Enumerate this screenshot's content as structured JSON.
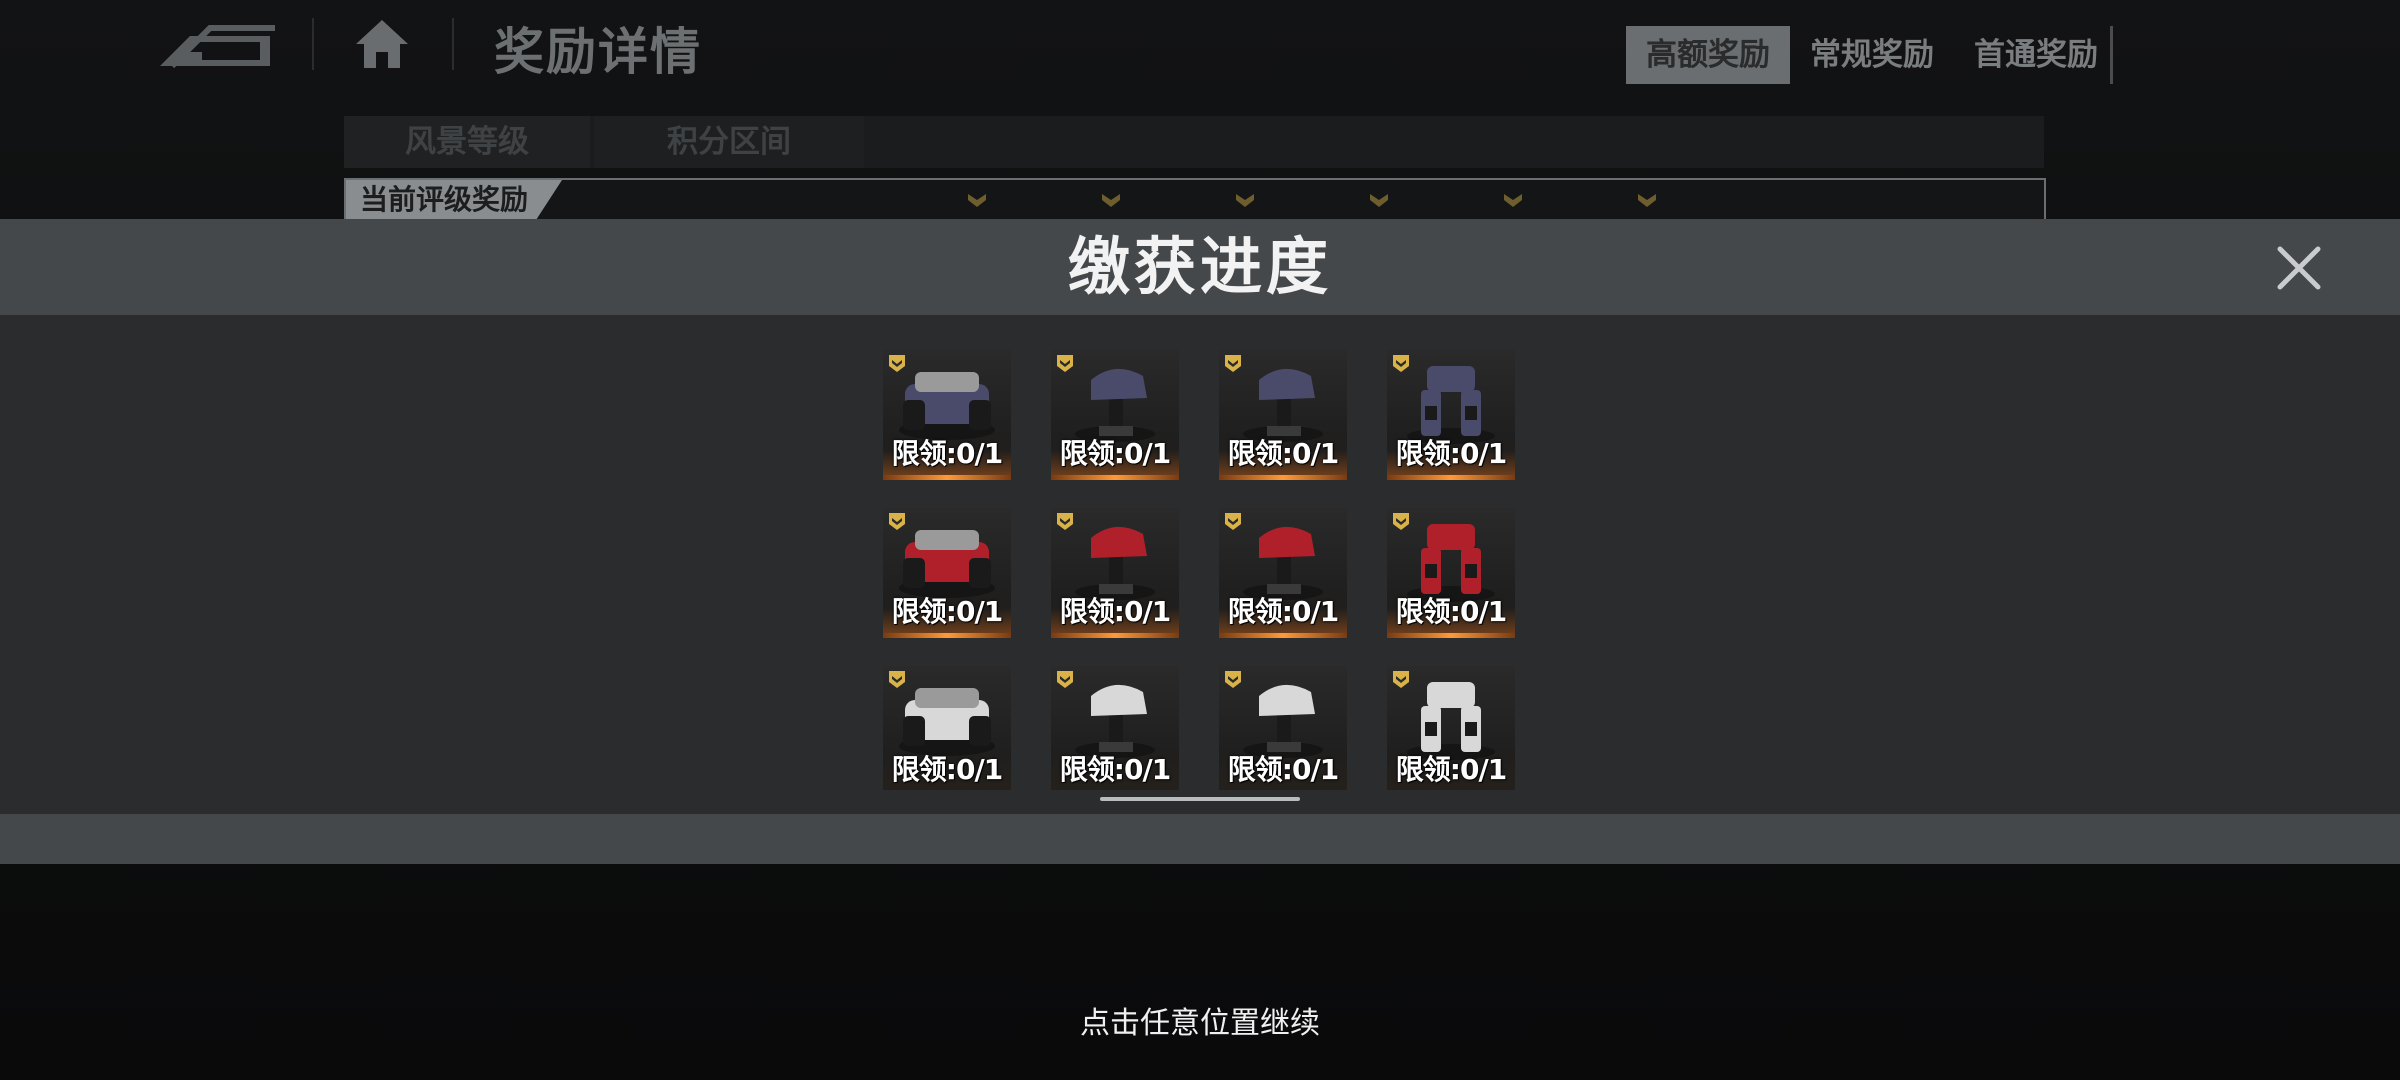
{
  "background": {
    "page_title": "奖励详情",
    "tabs": [
      {
        "label": "高额奖励",
        "active": true
      },
      {
        "label": "常规奖励",
        "active": false
      },
      {
        "label": "首通奖励",
        "active": false
      }
    ],
    "subhead": {
      "col1": "风景等级",
      "col2": "积分区间"
    },
    "rank_label": "当前评级奖励"
  },
  "modal": {
    "title": "缴获进度",
    "items": [
      {
        "name": "mech-part-1",
        "limit": "限领:0/1",
        "color": "#4a4a6a",
        "icon": "navy-shoulder-part",
        "glow": true
      },
      {
        "name": "mech-part-2",
        "limit": "限领:0/1",
        "color": "#4a4a6a",
        "icon": "navy-arm-part",
        "glow": true
      },
      {
        "name": "mech-part-3",
        "limit": "限领:0/1",
        "color": "#4a4a6a",
        "icon": "navy-arm-part",
        "glow": true
      },
      {
        "name": "mech-part-4",
        "limit": "限领:0/1",
        "color": "#4a4a6a",
        "icon": "navy-legs-part",
        "glow": true
      },
      {
        "name": "mech-part-5",
        "limit": "限领:0/1",
        "color": "#b0202a",
        "icon": "red-torso-part",
        "glow": true
      },
      {
        "name": "mech-part-6",
        "limit": "限领:0/1",
        "color": "#b0202a",
        "icon": "red-arm-part",
        "glow": true
      },
      {
        "name": "mech-part-7",
        "limit": "限领:0/1",
        "color": "#b0202a",
        "icon": "red-arm-part",
        "glow": true
      },
      {
        "name": "mech-part-8",
        "limit": "限领:0/1",
        "color": "#b0202a",
        "icon": "red-legs-part",
        "glow": true
      },
      {
        "name": "mech-part-9",
        "limit": "限领:0/1",
        "color": "#d8d8d8",
        "icon": "white-torso-part",
        "glow": false
      },
      {
        "name": "mech-part-10",
        "limit": "限领:0/1",
        "color": "#d8d8d8",
        "icon": "white-arm-part",
        "glow": false
      },
      {
        "name": "mech-part-11",
        "limit": "限领:0/1",
        "color": "#d8d8d8",
        "icon": "white-arm-part",
        "glow": false
      },
      {
        "name": "mech-part-12",
        "limit": "限领:0/1",
        "color": "#d8d8d8",
        "icon": "white-legs-part",
        "glow": false
      }
    ]
  },
  "continue_hint": "点击任意位置继续",
  "colors": {
    "badge_gold": "#d9b34a",
    "glow_orange": "#ff9a3a",
    "modal_header": "#45484b",
    "modal_body": "#2a2c2e"
  }
}
